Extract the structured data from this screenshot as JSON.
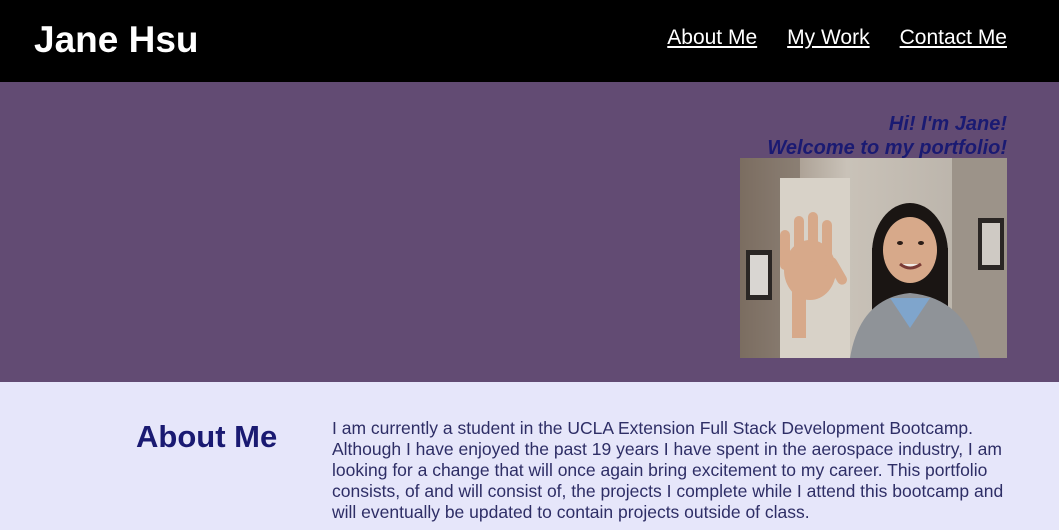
{
  "header": {
    "title": "Jane Hsu",
    "nav": [
      {
        "label": "About Me"
      },
      {
        "label": "My Work"
      },
      {
        "label": "Contact Me"
      }
    ]
  },
  "hero": {
    "greeting_line1": "Hi! I'm Jane!",
    "greeting_line2": "Welcome to my portfolio!",
    "photo_icon": "profile-photo"
  },
  "about": {
    "title": "About Me",
    "text": "I am currently a student in the UCLA Extension Full Stack Development Bootcamp. Although I have enjoyed the past 19 years I have spent in the aerospace industry, I am looking for a change that will once again bring excitement to my career. This portfolio consists, of and will consist of, the projects I complete while I attend this bootcamp and will eventually be updated to contain projects outside of class."
  },
  "colors": {
    "header_bg": "#000000",
    "hero_bg": "#624b73",
    "about_bg": "#e6e6fa",
    "accent_text": "#1a1a72"
  }
}
